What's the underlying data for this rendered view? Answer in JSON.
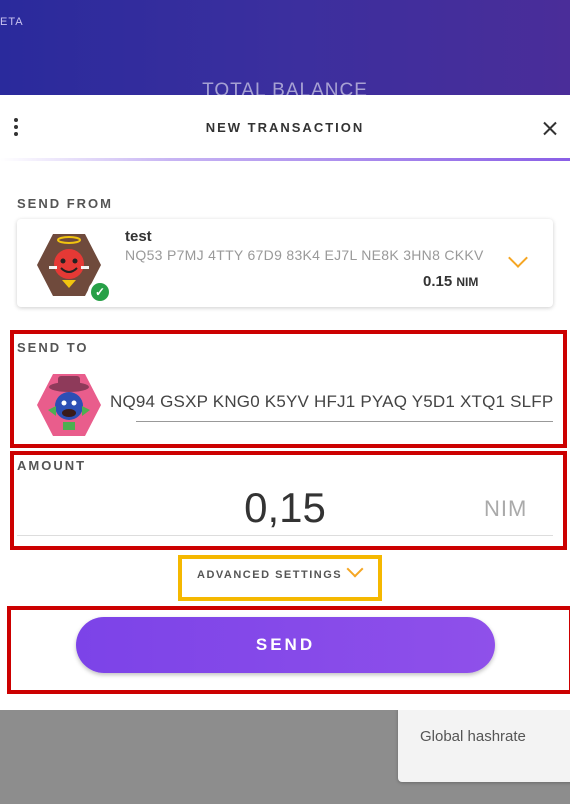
{
  "background": {
    "beta_label": "ETA",
    "balance_label": "TOTAL BALANCE",
    "hashrate_label": "Global hashrate"
  },
  "modal": {
    "title": "NEW TRANSACTION",
    "send_from": {
      "label": "SEND FROM",
      "account_name": "test",
      "address": "NQ53 P7MJ 4TTY 67D9 83K4 EJ7L NE8K 3HN8 CKKV",
      "balance_value": "0.15",
      "balance_unit": "NIM"
    },
    "send_to": {
      "label": "SEND TO",
      "address": "NQ94 GSXP KNG0 K5YV HFJ1 PYAQ Y5D1 XTQ1 SLFP"
    },
    "amount": {
      "label": "AMOUNT",
      "value": "0,15",
      "unit": "NIM"
    },
    "advanced_settings_label": "ADVANCED SETTINGS",
    "send_button_label": "SEND"
  },
  "colors": {
    "accent_purple": "#8a4fe8",
    "header_blue": "#2a2a9c",
    "chevron_orange": "#f5a623",
    "highlight_red": "#cc0000",
    "highlight_yellow": "#f5b800",
    "check_green": "#27a047"
  },
  "icons": [
    "more-vert-icon",
    "close-icon",
    "chevron-down-icon",
    "check-icon"
  ]
}
